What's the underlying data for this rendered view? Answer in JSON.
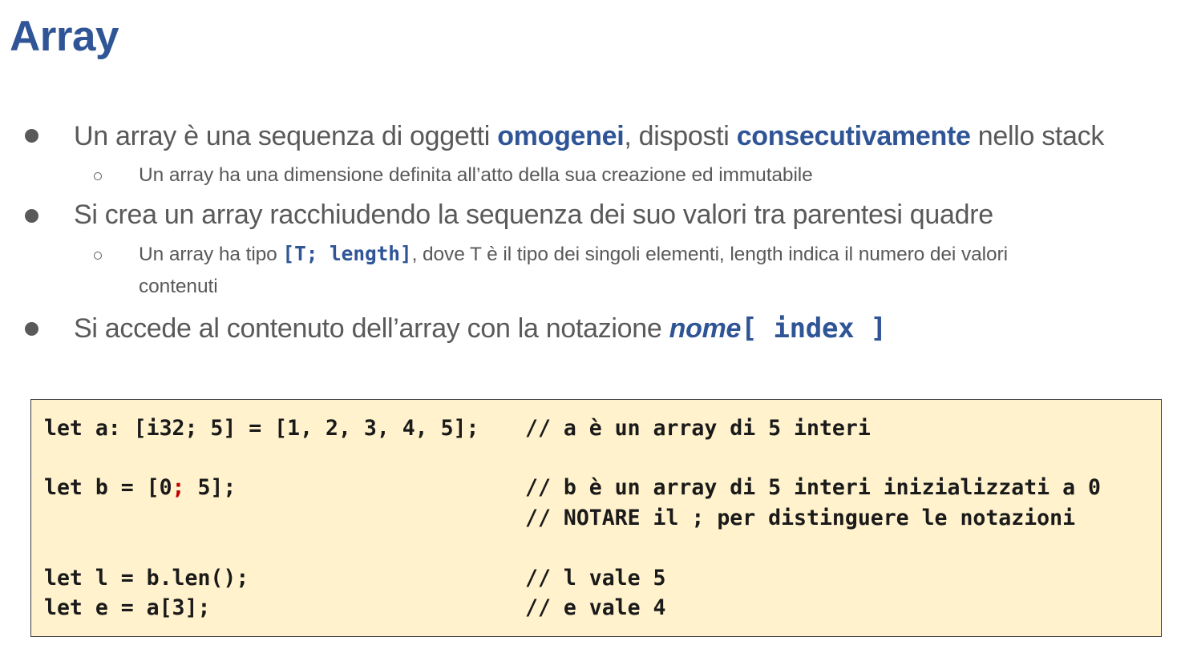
{
  "slide": {
    "title": "Array"
  },
  "bullets": {
    "b1": {
      "t1": "Un array è una sequenza di oggetti ",
      "e1": "omogenei",
      "t2": ", disposti ",
      "e2": "consecutivamente",
      "t3": " nello stack"
    },
    "b1_sub": "Un array ha una dimensione definita all’atto della sua creazione ed immutabile",
    "b2": "Si crea un array racchiudendo la sequenza dei suo valori tra parentesi quadre",
    "b2_sub": {
      "t1": "Un array ha tipo ",
      "code": "[T; length]",
      "t2": ", dove T è il tipo dei singoli elementi, length indica il numero dei valori",
      "t3": "contenuti"
    },
    "b3": {
      "t1": "Si accede al contenuto dell’array con la notazione ",
      "name": "nome",
      "code": "[ index ]"
    }
  },
  "code": {
    "line1": {
      "code": "let a: [i32; 5] = [1, 2, 3, 4, 5];",
      "comment": "// a è un array di 5 interi"
    },
    "line2": {
      "code_pre": "let b = [0",
      "code_semi": ";",
      "code_post": " 5];",
      "comment": "// b è un array di 5 interi inizializzati a 0"
    },
    "line3": {
      "comment": "// NOTARE il ; per distinguere le notazioni"
    },
    "line4": {
      "code": "let l = b.len();",
      "comment": "// l vale 5"
    },
    "line5": {
      "code": "let e = a[3];",
      "comment": "// e vale 4"
    }
  },
  "colors": {
    "accent": "#2f5597",
    "body_text": "#595959",
    "code_background": "#fff2cc",
    "highlight_semicolon": "#c00000"
  }
}
